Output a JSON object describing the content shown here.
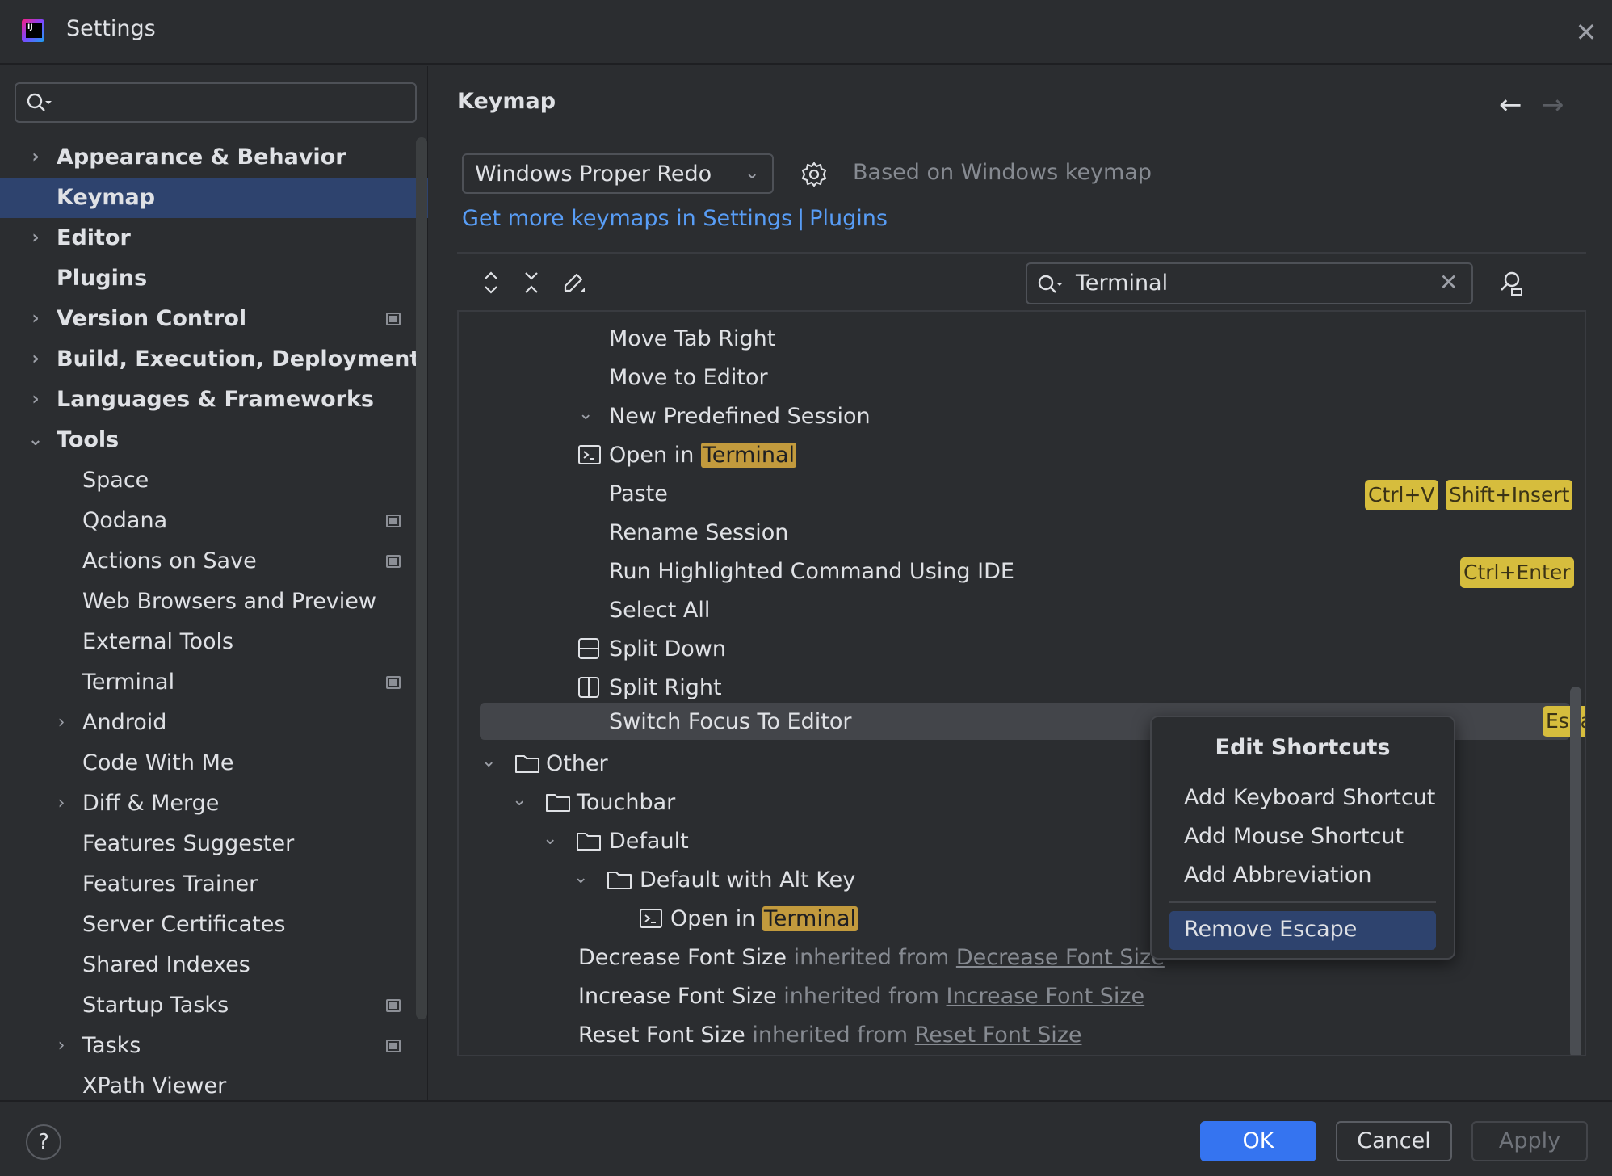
{
  "window": {
    "title": "Settings"
  },
  "sidebar": {
    "search_placeholder": "",
    "items": [
      {
        "label": "Appearance & Behavior",
        "expandable": true,
        "expanded": false,
        "level": 0,
        "selected": false,
        "badge": false
      },
      {
        "label": "Keymap",
        "expandable": false,
        "level": 0,
        "selected": true,
        "badge": false
      },
      {
        "label": "Editor",
        "expandable": true,
        "expanded": false,
        "level": 0,
        "selected": false,
        "badge": false
      },
      {
        "label": "Plugins",
        "expandable": false,
        "level": 0,
        "selected": false,
        "badge": false
      },
      {
        "label": "Version Control",
        "expandable": true,
        "expanded": false,
        "level": 0,
        "selected": false,
        "badge": true
      },
      {
        "label": "Build, Execution, Deployment",
        "expandable": true,
        "expanded": false,
        "level": 0,
        "selected": false,
        "badge": false
      },
      {
        "label": "Languages & Frameworks",
        "expandable": true,
        "expanded": false,
        "level": 0,
        "selected": false,
        "badge": false
      },
      {
        "label": "Tools",
        "expandable": true,
        "expanded": true,
        "level": 0,
        "selected": false,
        "badge": false
      },
      {
        "label": "Space",
        "expandable": false,
        "level": 1,
        "selected": false,
        "badge": false
      },
      {
        "label": "Qodana",
        "expandable": false,
        "level": 1,
        "selected": false,
        "badge": true
      },
      {
        "label": "Actions on Save",
        "expandable": false,
        "level": 1,
        "selected": false,
        "badge": true
      },
      {
        "label": "Web Browsers and Preview",
        "expandable": false,
        "level": 1,
        "selected": false,
        "badge": false
      },
      {
        "label": "External Tools",
        "expandable": false,
        "level": 1,
        "selected": false,
        "badge": false
      },
      {
        "label": "Terminal",
        "expandable": false,
        "level": 1,
        "selected": false,
        "badge": true
      },
      {
        "label": "Android",
        "expandable": true,
        "expanded": false,
        "level": 1,
        "selected": false,
        "badge": false
      },
      {
        "label": "Code With Me",
        "expandable": false,
        "level": 1,
        "selected": false,
        "badge": false
      },
      {
        "label": "Diff & Merge",
        "expandable": true,
        "expanded": false,
        "level": 1,
        "selected": false,
        "badge": false
      },
      {
        "label": "Features Suggester",
        "expandable": false,
        "level": 1,
        "selected": false,
        "badge": false
      },
      {
        "label": "Features Trainer",
        "expandable": false,
        "level": 1,
        "selected": false,
        "badge": false
      },
      {
        "label": "Server Certificates",
        "expandable": false,
        "level": 1,
        "selected": false,
        "badge": false
      },
      {
        "label": "Shared Indexes",
        "expandable": false,
        "level": 1,
        "selected": false,
        "badge": false
      },
      {
        "label": "Startup Tasks",
        "expandable": false,
        "level": 1,
        "selected": false,
        "badge": true
      },
      {
        "label": "Tasks",
        "expandable": true,
        "expanded": false,
        "level": 1,
        "selected": false,
        "badge": true
      },
      {
        "label": "XPath Viewer",
        "expandable": false,
        "level": 1,
        "selected": false,
        "badge": false
      }
    ]
  },
  "main": {
    "title": "Keymap",
    "keymap_select": "Windows Proper Redo",
    "based_on": "Based on Windows keymap",
    "link_settings": "Get more keymaps in Settings",
    "link_sep": "|",
    "link_plugins": "Plugins",
    "filter_value": "Terminal",
    "actions": {
      "move_tab_right": "Move Tab Right",
      "move_to_editor": "Move to Editor",
      "new_predefined_session": "New Predefined Session",
      "open_in": "Open in",
      "terminal_hl": "Terminal",
      "paste": "Paste",
      "paste_sc1": "Ctrl+V",
      "paste_sc2": "Shift+Insert",
      "rename_session": "Rename Session",
      "run_highlighted": "Run Highlighted Command Using IDE",
      "run_sc": "Ctrl+Enter",
      "select_all": "Select All",
      "split_down": "Split Down",
      "split_right": "Split Right",
      "switch_focus": "Switch Focus To Editor",
      "switch_sc": "Escape",
      "other": "Other",
      "touchbar": "Touchbar",
      "default": "Default",
      "default_alt": "Default with Alt Key",
      "open_in_2": "Open in",
      "terminal_hl_2": "Terminal",
      "dec_font": "Decrease Font Size",
      "inherited_from": "inherited from",
      "dec_font_link": "Decrease Font Size",
      "inc_font": "Increase Font Size",
      "inherited_from_2": "inherited from",
      "inc_font_link": "Increase Font Size",
      "reset_font": "Reset Font Size",
      "inherited_from_3": "inherited from",
      "reset_font_link": "Reset Font Size"
    }
  },
  "popup": {
    "title": "Edit Shortcuts",
    "add_keyboard": "Add Keyboard Shortcut",
    "add_mouse": "Add Mouse Shortcut",
    "add_abbrev": "Add Abbreviation",
    "remove": "Remove Escape"
  },
  "buttons": {
    "help": "?",
    "ok": "OK",
    "cancel": "Cancel",
    "apply": "Apply"
  },
  "colors": {
    "accent": "#3574F0",
    "selection": "#2E436E",
    "shortcut": "#D6BD3D",
    "highlight": "#C29A3D",
    "link": "#589DF6"
  }
}
